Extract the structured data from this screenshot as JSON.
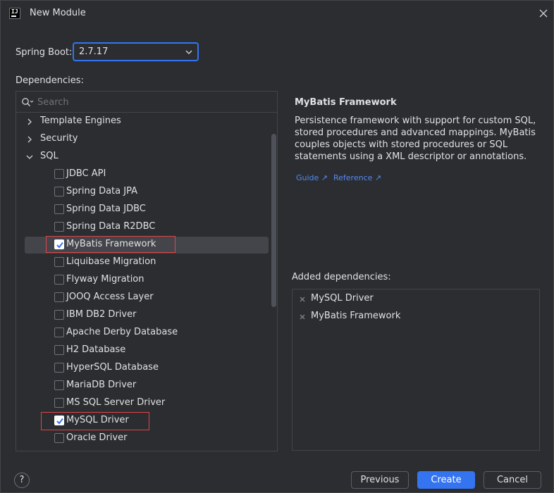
{
  "window": {
    "title": "New Module",
    "app_icon_text": "IJ"
  },
  "spring_boot": {
    "label": "Spring Boot:",
    "version": "2.7.17"
  },
  "dependencies": {
    "label": "Dependencies:",
    "search_placeholder": "Search",
    "categories": [
      {
        "label": "Template Engines",
        "expanded": false
      },
      {
        "label": "Security",
        "expanded": false
      },
      {
        "label": "SQL",
        "expanded": true
      }
    ],
    "sql_items": [
      {
        "label": "JDBC API",
        "checked": false
      },
      {
        "label": "Spring Data JPA",
        "checked": false
      },
      {
        "label": "Spring Data JDBC",
        "checked": false
      },
      {
        "label": "Spring Data R2DBC",
        "checked": false
      },
      {
        "label": "MyBatis Framework",
        "checked": true
      },
      {
        "label": "Liquibase Migration",
        "checked": false
      },
      {
        "label": "Flyway Migration",
        "checked": false
      },
      {
        "label": "JOOQ Access Layer",
        "checked": false
      },
      {
        "label": "IBM DB2 Driver",
        "checked": false
      },
      {
        "label": "Apache Derby Database",
        "checked": false
      },
      {
        "label": "H2 Database",
        "checked": false
      },
      {
        "label": "HyperSQL Database",
        "checked": false
      },
      {
        "label": "MariaDB Driver",
        "checked": false
      },
      {
        "label": "MS SQL Server Driver",
        "checked": false
      },
      {
        "label": "MySQL Driver",
        "checked": true
      },
      {
        "label": "Oracle Driver",
        "checked": false
      }
    ]
  },
  "details": {
    "title": "MyBatis Framework",
    "description": "Persistence framework with support for custom SQL, stored procedures and advanced mappings. MyBatis couples objects with stored procedures or SQL statements using a XML descriptor or annotations.",
    "links": [
      "Guide ↗",
      "Reference ↗"
    ]
  },
  "added": {
    "label": "Added dependencies:",
    "items": [
      "MySQL Driver",
      "MyBatis Framework"
    ]
  },
  "footer": {
    "help": "?",
    "previous": "Previous",
    "create": "Create",
    "cancel": "Cancel"
  },
  "colors": {
    "accent": "#3574f0",
    "highlight_box": "#e0454a",
    "link": "#548af7",
    "background": "#2b2d30"
  }
}
